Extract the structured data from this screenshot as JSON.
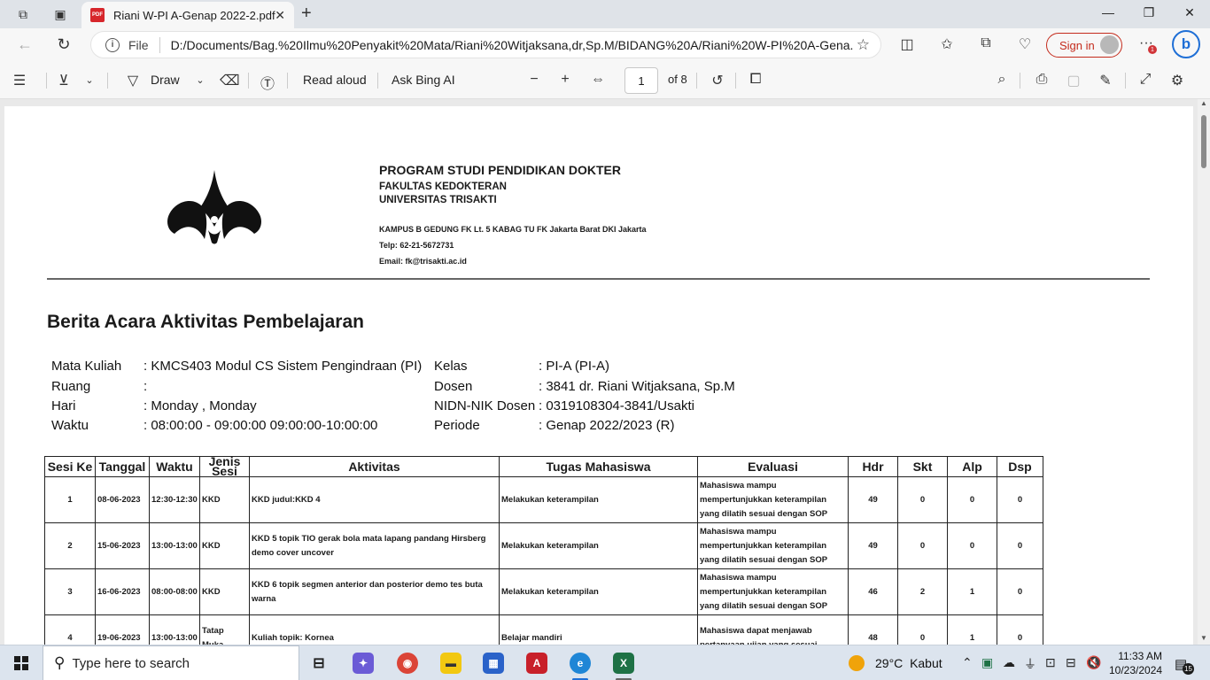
{
  "browser": {
    "tab_title": "Riani W-PI A-Genap 2022-2.pdf",
    "url_scheme_label": "File",
    "url": "D:/Documents/Bag.%20Ilmu%20Penyakit%20Mata/Riani%20Witjaksana,dr,Sp.M/BIDANG%20A/Riani%20W-PI%20A-Gena...",
    "sign_in_label": "Sign in",
    "notification_count": "1"
  },
  "pdf_toolbar": {
    "draw_label": "Draw",
    "read_aloud_label": "Read aloud",
    "ask_bing_label": "Ask Bing AI",
    "page_number": "1",
    "page_total": "of 8"
  },
  "document": {
    "program": "PROGRAM STUDI PENDIDIKAN DOKTER",
    "faculty": "FAKULTAS KEDOKTERAN",
    "university": "UNIVERSITAS TRISAKTI",
    "address": "KAMPUS B GEDUNG FK Lt. 5 KABAG TU FK Jakarta Barat DKI Jakarta",
    "phone": "Telp: 62-21-5672731",
    "email": "Email: fk@trisakti.ac.id",
    "title": "Berita Acara Aktivitas Pembelajaran",
    "info_left": [
      {
        "label": "Mata Kuliah",
        "value": ": KMCS403  Modul CS Sistem Pengindraan (PI)"
      },
      {
        "label": "Ruang",
        "value": ":"
      },
      {
        "label": "Hari",
        "value": ": Monday , Monday"
      },
      {
        "label": "Waktu",
        "value": ": 08:00:00 - 09:00:00 09:00:00-10:00:00"
      }
    ],
    "info_right": [
      {
        "label": "Kelas",
        "value": ": PI-A (PI-A)"
      },
      {
        "label": "Dosen",
        "value": ": 3841 dr. Riani Witjaksana, Sp.M"
      },
      {
        "label": "NIDN-NIK Dosen",
        "value": ": 0319108304-3841/Usakti"
      },
      {
        "label": "Periode",
        "value": ": Genap 2022/2023 (R)"
      }
    ],
    "table": {
      "headers": [
        "Sesi Ke",
        "Tanggal",
        "Waktu",
        "Jenis Sesi",
        "Aktivitas",
        "Tugas Mahasiswa",
        "Evaluasi",
        "Hdr",
        "Skt",
        "Alp",
        "Dsp"
      ],
      "rows": [
        {
          "sesi": "1",
          "tanggal": "08-06-2023",
          "waktu": "12:30-12:30",
          "jenis": "KKD",
          "aktivitas": "KKD judul:KKD 4",
          "tugas": "Melakukan keterampilan",
          "evaluasi": "Mahasiswa mampu mempertunjukkan keterampilan yang dilatih sesuai dengan SOP",
          "hdr": "49",
          "skt": "0",
          "alp": "0",
          "dsp": "0"
        },
        {
          "sesi": "2",
          "tanggal": "15-06-2023",
          "waktu": "13:00-13:00",
          "jenis": "KKD",
          "aktivitas": "KKD 5 topik TIO gerak bola mata lapang pandang Hirsberg demo cover uncover",
          "tugas": "Melakukan keterampilan",
          "evaluasi": "Mahasiswa mampu mempertunjukkan keterampilan yang dilatih sesuai dengan SOP",
          "hdr": "49",
          "skt": "0",
          "alp": "0",
          "dsp": "0"
        },
        {
          "sesi": "3",
          "tanggal": "16-06-2023",
          "waktu": "08:00-08:00",
          "jenis": "KKD",
          "aktivitas": "KKD 6 topik segmen anterior dan posterior demo tes buta warna",
          "tugas": "Melakukan keterampilan",
          "evaluasi": "Mahasiswa mampu mempertunjukkan keterampilan yang dilatih sesuai dengan SOP",
          "hdr": "46",
          "skt": "2",
          "alp": "1",
          "dsp": "0"
        },
        {
          "sesi": "4",
          "tanggal": "19-06-2023",
          "waktu": "13:00-13:00",
          "jenis": "Tatap Muka",
          "aktivitas": "Kuliah topik: Kornea",
          "tugas": "Belajar mandiri",
          "evaluasi": "Mahasiswa dapat menjawab pertanyaan ujian yang sesuai",
          "hdr": "48",
          "skt": "0",
          "alp": "1",
          "dsp": "0"
        }
      ]
    }
  },
  "taskbar": {
    "search_placeholder": "Type here to search",
    "temperature": "29°C",
    "weather": "Kabut",
    "time": "11:33 AM",
    "date": "10/23/2024",
    "notification_count": "15"
  }
}
